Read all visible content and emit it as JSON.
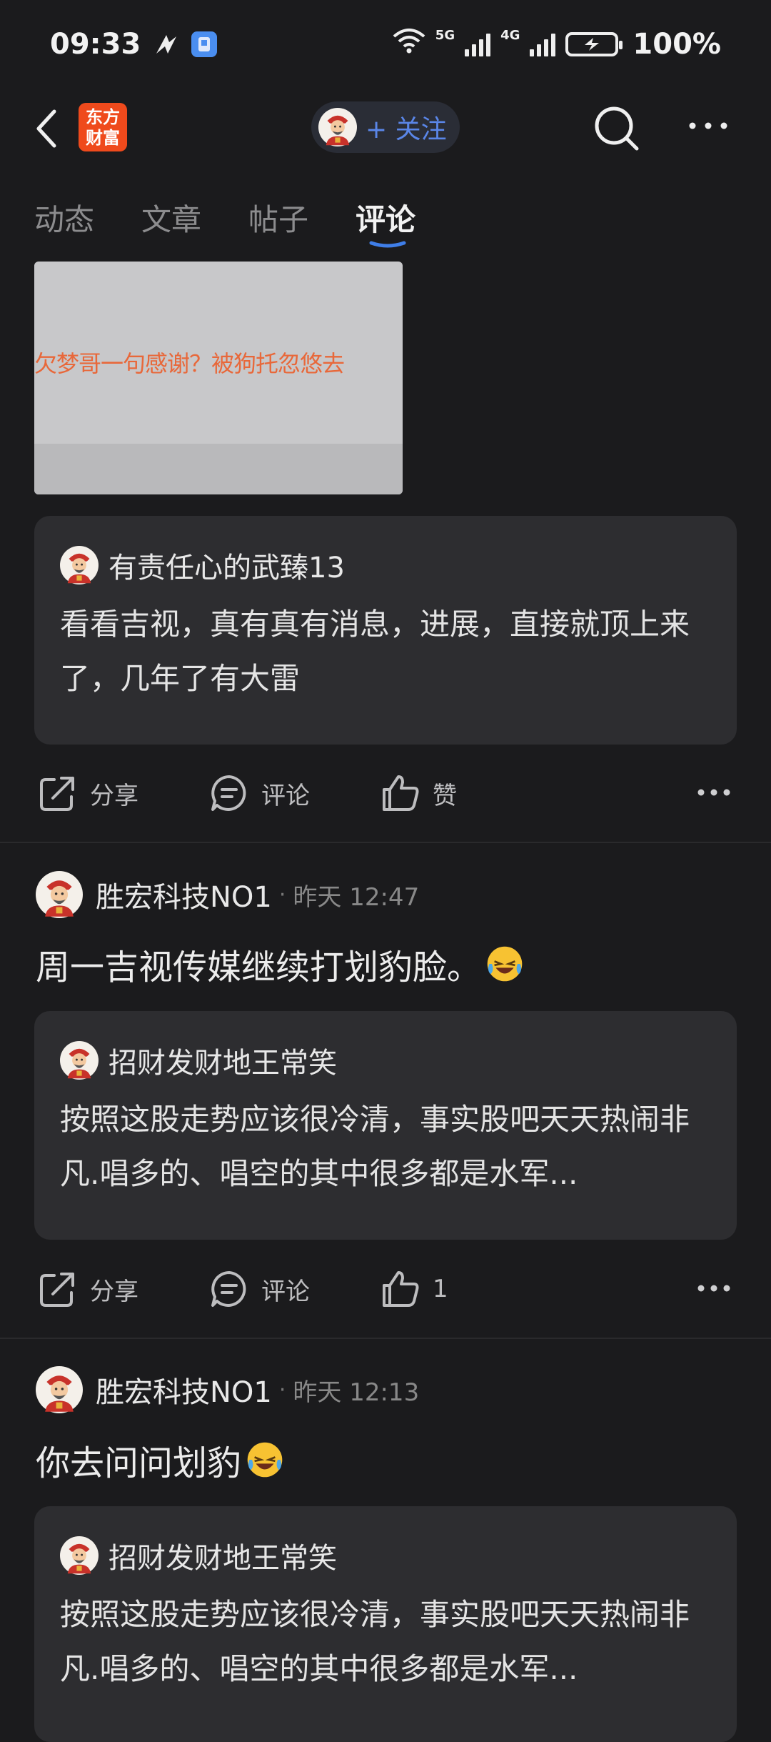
{
  "status_bar": {
    "time": "09:33",
    "battery": "100%",
    "net1": "5G",
    "net2": "4G"
  },
  "header": {
    "logo_line1": "东方",
    "logo_line2": "财富",
    "follow_label": "+ 关注"
  },
  "tabs": [
    "动态",
    "文章",
    "帖子",
    "评论"
  ],
  "active_tab": "评论",
  "image_card": {
    "text": "欠梦哥一句感谢？被狗托忽悠去"
  },
  "items": [
    {
      "quote": {
        "author": "有责任心的武臻13",
        "text": "看看吉视，真有真有消息，进展，直接就顶上来了，几年了有大雷"
      },
      "actions": {
        "share": "分享",
        "comment": "评论",
        "like": "赞"
      }
    },
    {
      "author": "胜宏科技NO1",
      "sep": "·",
      "time": "昨天 12:47",
      "text": "周一吉视传媒继续打划豹脸。",
      "quote": {
        "author": "招财发财地王常笑",
        "text": "按照这股走势应该很冷清，事实股吧天天热闹非凡.唱多的、唱空的其中很多都是水军..."
      },
      "actions": {
        "share": "分享",
        "comment": "评论",
        "like": "1"
      }
    },
    {
      "author": "胜宏科技NO1",
      "sep": "·",
      "time": "昨天 12:13",
      "text": "你去问问划豹",
      "quote": {
        "author": "招财发财地王常笑",
        "text": "按照这股走势应该很冷清，事实股吧天天热闹非凡.唱多的、唱空的其中很多都是水军..."
      }
    }
  ],
  "colors": {
    "background": "#1b1b1d",
    "card": "#2d2d30",
    "accent_blue": "#5a86e8",
    "logo_orange": "#ef4a1c"
  }
}
